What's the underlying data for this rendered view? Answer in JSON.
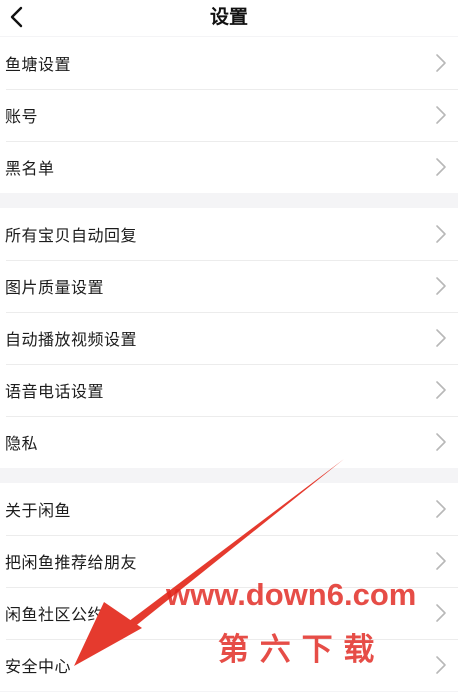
{
  "header": {
    "title": "设置",
    "back_icon": "chevron-left-icon"
  },
  "groups": [
    {
      "items": [
        {
          "label": "鱼塘设置"
        },
        {
          "label": "账号"
        },
        {
          "label": "黑名单"
        }
      ]
    },
    {
      "items": [
        {
          "label": "所有宝贝自动回复"
        },
        {
          "label": "图片质量设置"
        },
        {
          "label": "自动播放视频设置"
        },
        {
          "label": "语音电话设置"
        },
        {
          "label": "隐私"
        }
      ]
    },
    {
      "items": [
        {
          "label": "关于闲鱼"
        },
        {
          "label": "把闲鱼推荐给朋友"
        },
        {
          "label": "闲鱼社区公约"
        },
        {
          "label": "安全中心"
        }
      ]
    }
  ],
  "watermark": {
    "site": "www.down6.com",
    "name": "第 六 下 载",
    "color": "#e0261e"
  },
  "colors": {
    "background": "#f4f4f6",
    "row": "#ffffff",
    "divider": "#ececec",
    "chevron": "#b8b8b8",
    "annotation_arrow": "#e53a2e"
  }
}
